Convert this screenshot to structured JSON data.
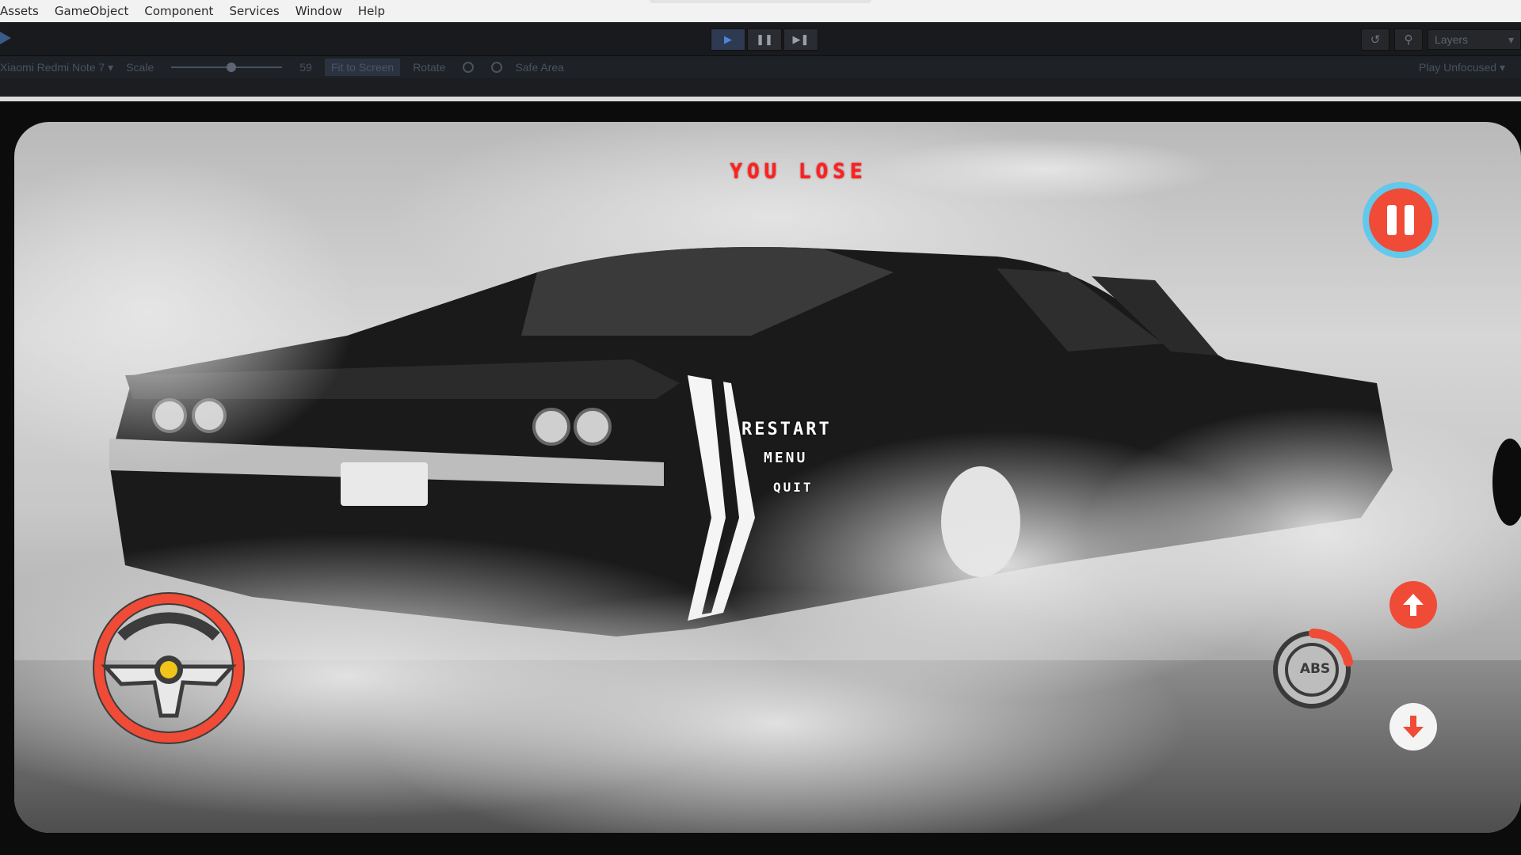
{
  "editor": {
    "menu": [
      "Assets",
      "GameObject",
      "Component",
      "Services",
      "Window",
      "Help"
    ],
    "toolbar": {
      "layers_label": "Layers"
    },
    "gameview": {
      "device": "Xiaomi Redmi Note 7",
      "scale_label": "Scale",
      "scale_value": "59",
      "fit_label": "Fit to Screen",
      "rotate_label": "Rotate",
      "safe_area_label": "Safe Area",
      "play_mode": "Play Unfocused"
    }
  },
  "game": {
    "title": "YOU LOSE",
    "options": {
      "restart": "RESTART",
      "menu": "MENU",
      "quit": "QUIT"
    },
    "abs_label": "ABS"
  },
  "colors": {
    "accent_red": "#ef4b36",
    "pause_ring": "#62c8ec",
    "title_red": "#ff2020"
  }
}
